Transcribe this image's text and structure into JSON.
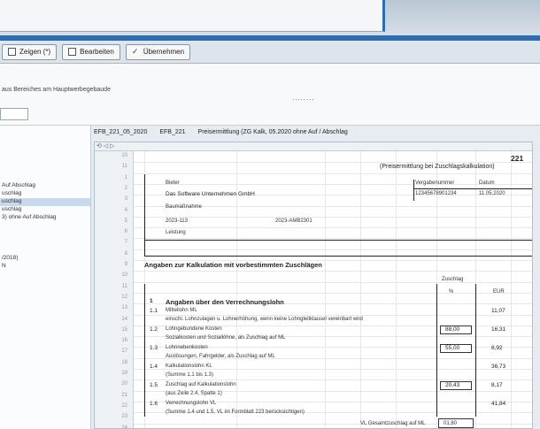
{
  "toolbar": {
    "buttons": [
      {
        "label": "Zeigen (*)",
        "icon": "checkbox-icon"
      },
      {
        "label": "Bearbeiten",
        "icon": "edit-icon"
      },
      {
        "label": "Übernehmen",
        "icon": "check-icon"
      }
    ]
  },
  "subhead": {
    "hint": "aus Bereiches am Hauptwerbegebaude",
    "dots": "........"
  },
  "sidebar": {
    "items": [
      "Auf Abschlag",
      "uschlag",
      "uschlag",
      "uschlag",
      "3) ohne Auf Abschlag",
      "/2018)",
      "N"
    ],
    "selected_index": 2
  },
  "doctabs": {
    "tab1": "EFB_221_05_2020",
    "tab2": "EFB_221",
    "tab3": "Preisermittlung (ZG Kalk, 05.2020 ohne Auf / Abschlag"
  },
  "sheet": {
    "nav": "⟲ ◁ ▷",
    "row_numbers": [
      "10",
      "11",
      "1",
      "2",
      "3",
      "4",
      "5",
      "6",
      "7",
      "8",
      "9",
      "10",
      "11",
      "12",
      "13",
      "14",
      "15",
      "16",
      "17",
      "18",
      "19",
      "20",
      "21",
      "22",
      "23",
      "24"
    ],
    "form_number": "221",
    "form_title": "(Preisermittlung bei Zuschlagskalkulation)",
    "bieter_label": "Bieter",
    "bieter_value": "Das Software Unternehmen GmbH",
    "vergabe_label": "Vergabenummer",
    "datum_label": "Datum",
    "vergabe_value": "12345678901234",
    "datum_value": "11.05.2020",
    "baumassnahme_label": "Baumaßnahme",
    "massnahme_code": "2023-113",
    "massnahme_ref": "2023-AMB2301",
    "leistung_label": "Leistung",
    "section_title": "Angaben zur Kalkulation mit vorbestimmten Zuschlägen",
    "col_zuschlag": "Zuschlag",
    "col_pct": "%",
    "col_eur": "EUR",
    "lines": [
      {
        "no": "1",
        "text": "Angaben über den Verrechnungslohn",
        "bold": true
      },
      {
        "no": "1.1",
        "text": "Mittellohn ML",
        "value": "11,07"
      },
      {
        "no": "",
        "text": "einschl. Lohnzulagen u. Lohnerhöhung, wenn keine Lohngleitklausel vereinbart wird"
      },
      {
        "no": "1.2",
        "text": "Lohngebundene Kosten",
        "pct": "88,00",
        "value": "16,31"
      },
      {
        "no": "",
        "text": "Sozialkosten und Soziallöhne, als Zuschlag auf ML"
      },
      {
        "no": "1.3",
        "text": "Lohnnebenkosten",
        "pct": "55,00",
        "value": "8,92"
      },
      {
        "no": "",
        "text": "Auslösungen, Fahrgelder, als Zuschlag auf ML"
      },
      {
        "no": "1.4",
        "text": "Kalkulationslohn KL",
        "value": "36,73"
      },
      {
        "no": "",
        "text": "(Summe 1.1 bis 1.3)"
      },
      {
        "no": "1.5",
        "text": "Zuschlag auf Kalkulationslohn",
        "pct": "20,43",
        "value": "8,17"
      },
      {
        "no": "",
        "text": "(aus Zeile 2.4, Spalte 1)"
      },
      {
        "no": "1.6",
        "text": "Verrechnungslohn VL",
        "value": "41,84"
      },
      {
        "no": "",
        "text": "(Summe 1.4 und 1.5, VL im Formblatt 223 berücksichtigen)"
      }
    ],
    "footer_label": "VL Gesamtzuschlag auf ML",
    "footer_value": "01,80"
  }
}
